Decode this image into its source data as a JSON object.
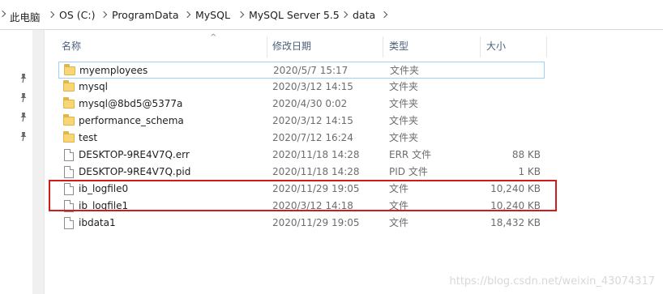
{
  "breadcrumb": [
    "此电脑",
    "OS (C:)",
    "ProgramData",
    "MySQL",
    "MySQL Server 5.5",
    "data"
  ],
  "columns": {
    "name": "名称",
    "modified": "修改日期",
    "type": "类型",
    "size": "大小"
  },
  "files": [
    {
      "name": "myemployees",
      "modified": "2020/5/7 15:17",
      "type": "文件夹",
      "size": "",
      "icon": "folder-icon"
    },
    {
      "name": "mysql",
      "modified": "2020/3/12 14:15",
      "type": "文件夹",
      "size": "",
      "icon": "folder-icon"
    },
    {
      "name": "mysql@8bd5@5377a",
      "modified": "2020/4/30 0:02",
      "type": "文件夹",
      "size": "",
      "icon": "folder-icon"
    },
    {
      "name": "performance_schema",
      "modified": "2020/3/12 14:15",
      "type": "文件夹",
      "size": "",
      "icon": "folder-icon"
    },
    {
      "name": "test",
      "modified": "2020/7/12 16:24",
      "type": "文件夹",
      "size": "",
      "icon": "folder-icon"
    },
    {
      "name": "DESKTOP-9RE4V7Q.err",
      "modified": "2020/11/18 14:28",
      "type": "ERR 文件",
      "size": "88 KB",
      "icon": "file-icon"
    },
    {
      "name": "DESKTOP-9RE4V7Q.pid",
      "modified": "2020/11/18 14:28",
      "type": "PID 文件",
      "size": "1 KB",
      "icon": "file-icon"
    },
    {
      "name": "ib_logfile0",
      "modified": "2020/11/29 19:05",
      "type": "文件",
      "size": "10,240 KB",
      "icon": "file-icon"
    },
    {
      "name": "ib_logfile1",
      "modified": "2020/3/12 14:18",
      "type": "文件",
      "size": "10,240 KB",
      "icon": "file-icon"
    },
    {
      "name": "ibdata1",
      "modified": "2020/11/29 19:05",
      "type": "文件",
      "size": "18,432 KB",
      "icon": "file-icon"
    }
  ],
  "watermark": "https://blog.csdn.net/weixin_43074317",
  "colors": {
    "folder": "#f8d675",
    "highlight": "#d21b1b",
    "header_text": "#4c607a"
  }
}
